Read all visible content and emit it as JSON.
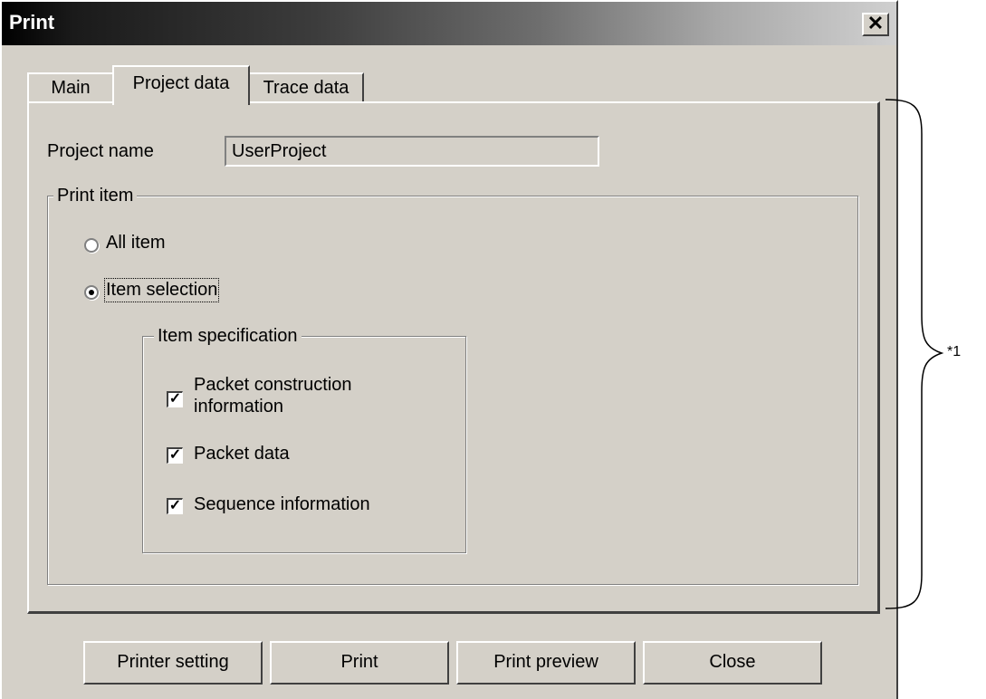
{
  "window": {
    "title": "Print",
    "close_glyph": "✕"
  },
  "tabs": [
    {
      "label": "Main",
      "selected": false
    },
    {
      "label": "Project data",
      "selected": true
    },
    {
      "label": "Trace data",
      "selected": false
    }
  ],
  "project": {
    "name_label": "Project name",
    "name_value": "UserProject"
  },
  "print_item": {
    "legend": "Print item",
    "options": [
      {
        "label": "All item",
        "selected": false
      },
      {
        "label": "Item selection",
        "selected": true
      }
    ]
  },
  "item_specification": {
    "legend": "Item specification",
    "checks": [
      {
        "label_line1": "Packet construction",
        "label_line2": "information",
        "checked": true
      },
      {
        "label": "Packet data",
        "checked": true
      },
      {
        "label": "Sequence information",
        "checked": true
      }
    ],
    "check_mark": "✓"
  },
  "buttons": {
    "printer_setting": "Printer setting",
    "print": "Print",
    "print_preview": "Print preview",
    "close": "Close"
  },
  "annotation": {
    "text": "*1"
  }
}
